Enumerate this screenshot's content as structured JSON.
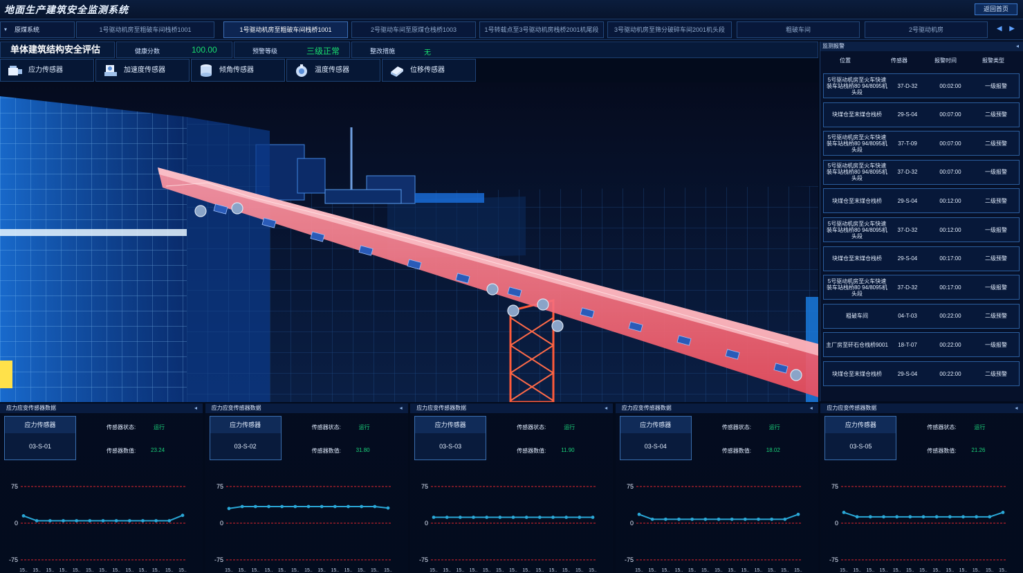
{
  "app": {
    "title": "地面生产建筑安全监测系统",
    "home_button": "返回首页"
  },
  "tabs": {
    "system": "原煤系统",
    "items": [
      "1号驱动机房至粗破车间栈桥1001",
      "1号驱动机房至粗破车间栈桥1001",
      "2号驱动车间至原煤仓栈桥1003",
      "1号转载点至3号驱动机房栈桥2001机尾段",
      "3号驱动机房至筛分破碎车间2001机头段",
      "粗破车间",
      "2号驱动机房"
    ],
    "arrows": "◀ ▶"
  },
  "assessment": {
    "title": "单体建筑结构安全评估",
    "health_label": "健康分数",
    "health_value": "100.00",
    "warning_label": "预警等级",
    "warning_value": "三级正常",
    "measure_label": "整改措施",
    "measure_value": "无"
  },
  "sensors": [
    "应力传感器",
    "加速度传感器",
    "倾角传感器",
    "温度传感器",
    "位移传感器"
  ],
  "alarm": {
    "title": "监测报警",
    "collapse": "◂",
    "columns": [
      "位置",
      "传感器",
      "报警时间",
      "报警类型"
    ],
    "rows": [
      {
        "location": "5号驱动机房至火车快速装车站栈桥80 94/8095机头段",
        "sensor": "37-D-32",
        "time": "00:02:00",
        "type": "一级报警"
      },
      {
        "location": "块煤仓至末煤仓栈桥",
        "sensor": "29-S-04",
        "time": "00:07:00",
        "type": "二级预警"
      },
      {
        "location": "5号驱动机房至火车快速装车站栈桥80 94/8095机头段",
        "sensor": "37-T-09",
        "time": "00:07:00",
        "type": "二级预警"
      },
      {
        "location": "5号驱动机房至火车快速装车站栈桥80 94/8095机头段",
        "sensor": "37-D-32",
        "time": "00:07:00",
        "type": "一级报警"
      },
      {
        "location": "块煤仓至末煤仓栈桥",
        "sensor": "29-S-04",
        "time": "00:12:00",
        "type": "二级预警"
      },
      {
        "location": "5号驱动机房至火车快速装车站栈桥80 94/8095机头段",
        "sensor": "37-D-32",
        "time": "00:12:00",
        "type": "一级报警"
      },
      {
        "location": "块煤仓至末煤仓栈桥",
        "sensor": "29-S-04",
        "time": "00:17:00",
        "type": "二级预警"
      },
      {
        "location": "5号驱动机房至火车快速装车站栈桥80 94/8095机头段",
        "sensor": "37-D-32",
        "time": "00:17:00",
        "type": "一级报警"
      },
      {
        "location": "粗破车间",
        "sensor": "04-T-03",
        "time": "00:22:00",
        "type": "二级预警"
      },
      {
        "location": "主厂房至矸石仓栈桥9001",
        "sensor": "18-T-07",
        "time": "00:22:00",
        "type": "一级报警"
      },
      {
        "location": "块煤仓至末煤仓栈桥",
        "sensor": "29-S-04",
        "time": "00:22:00",
        "type": "二级预警"
      }
    ]
  },
  "panels": [
    {
      "header": "应力应变传感器数据",
      "card_title": "应力传感器",
      "card_id": "03-S-01",
      "status_label": "传感器状态:",
      "status": "运行",
      "value_label": "传感器数值:",
      "value": "23.24"
    },
    {
      "header": "应力应变传感器数据",
      "card_title": "应力传感器",
      "card_id": "03-S-02",
      "status_label": "传感器状态:",
      "status": "运行",
      "value_label": "传感器数值:",
      "value": "31.80"
    },
    {
      "header": "应力应变传感器数据",
      "card_title": "应力传感器",
      "card_id": "03-S-03",
      "status_label": "传感器状态:",
      "status": "运行",
      "value_label": "传感器数值:",
      "value": "11.90"
    },
    {
      "header": "应力应变传感器数据",
      "card_title": "应力传感器",
      "card_id": "03-S-04",
      "status_label": "传感器状态:",
      "status": "运行",
      "value_label": "传感器数值:",
      "value": "18.02"
    },
    {
      "header": "应力应变传感器数据",
      "card_title": "应力传感器",
      "card_id": "03-S-05",
      "status_label": "传感器状态:",
      "status": "运行",
      "value_label": "传感器数值:",
      "value": "21.26"
    }
  ],
  "chart_data": [
    {
      "type": "line",
      "ylim": [
        -75,
        75
      ],
      "yticks": [
        "75",
        "0",
        "-75"
      ],
      "xtick": "15..",
      "threshold_color": "#e0242c",
      "line_color": "#2aa7d6",
      "values": [
        15,
        5,
        5,
        5,
        5,
        5,
        5,
        5,
        5,
        5,
        5,
        5,
        16
      ]
    },
    {
      "type": "line",
      "ylim": [
        -75,
        75
      ],
      "yticks": [
        "75",
        "0",
        "-75"
      ],
      "xtick": "15..",
      "threshold_color": "#e0242c",
      "line_color": "#2aa7d6",
      "values": [
        30,
        34,
        34,
        34,
        34,
        34,
        34,
        34,
        34,
        34,
        34,
        34,
        31
      ]
    },
    {
      "type": "line",
      "ylim": [
        -75,
        75
      ],
      "yticks": [
        "75",
        "0",
        "-75"
      ],
      "xtick": "15..",
      "threshold_color": "#e0242c",
      "line_color": "#2aa7d6",
      "values": [
        12,
        12,
        12,
        12,
        12,
        12,
        12,
        12,
        12,
        12,
        12,
        12,
        12
      ]
    },
    {
      "type": "line",
      "ylim": [
        -75,
        75
      ],
      "yticks": [
        "75",
        "0",
        "-75"
      ],
      "xtick": "15..",
      "threshold_color": "#e0242c",
      "line_color": "#2aa7d6",
      "values": [
        18,
        8,
        8,
        8,
        8,
        8,
        8,
        8,
        8,
        8,
        8,
        8,
        18
      ]
    },
    {
      "type": "line",
      "ylim": [
        -75,
        75
      ],
      "yticks": [
        "75",
        "0",
        "-75"
      ],
      "xtick": "15..",
      "threshold_color": "#e0242c",
      "line_color": "#2aa7d6",
      "values": [
        22,
        13,
        13,
        13,
        13,
        13,
        13,
        13,
        13,
        13,
        13,
        13,
        22
      ]
    }
  ]
}
